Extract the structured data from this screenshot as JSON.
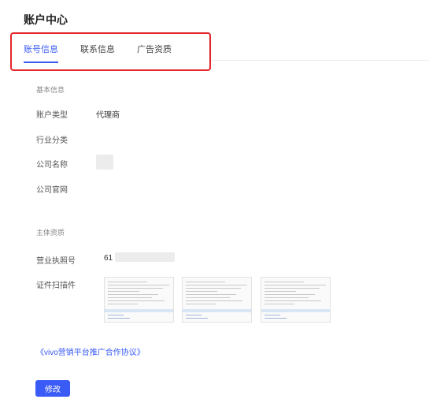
{
  "page": {
    "title": "账户中心"
  },
  "tabs": [
    {
      "label": "账号信息",
      "active": true
    },
    {
      "label": "联系信息",
      "active": false
    },
    {
      "label": "广告资质",
      "active": false
    }
  ],
  "basic_info": {
    "section_label": "基本信息",
    "account_type": {
      "label": "账户类型",
      "value": "代理商"
    },
    "industry": {
      "label": "行业分类",
      "value": ""
    },
    "company_name": {
      "label": "公司名称",
      "value": ""
    },
    "company_website": {
      "label": "公司官网",
      "value": ""
    }
  },
  "qualification": {
    "section_label": "主体资质",
    "license_number": {
      "label": "营业执照号",
      "value": "61"
    },
    "scans": {
      "label": "证件扫描件",
      "count": 3
    }
  },
  "agreement_link": "《vivo营销平台推广合作协议》",
  "edit_button": "修改",
  "colors": {
    "accent": "#3b5bf6",
    "highlight_border": "#e4262a"
  }
}
